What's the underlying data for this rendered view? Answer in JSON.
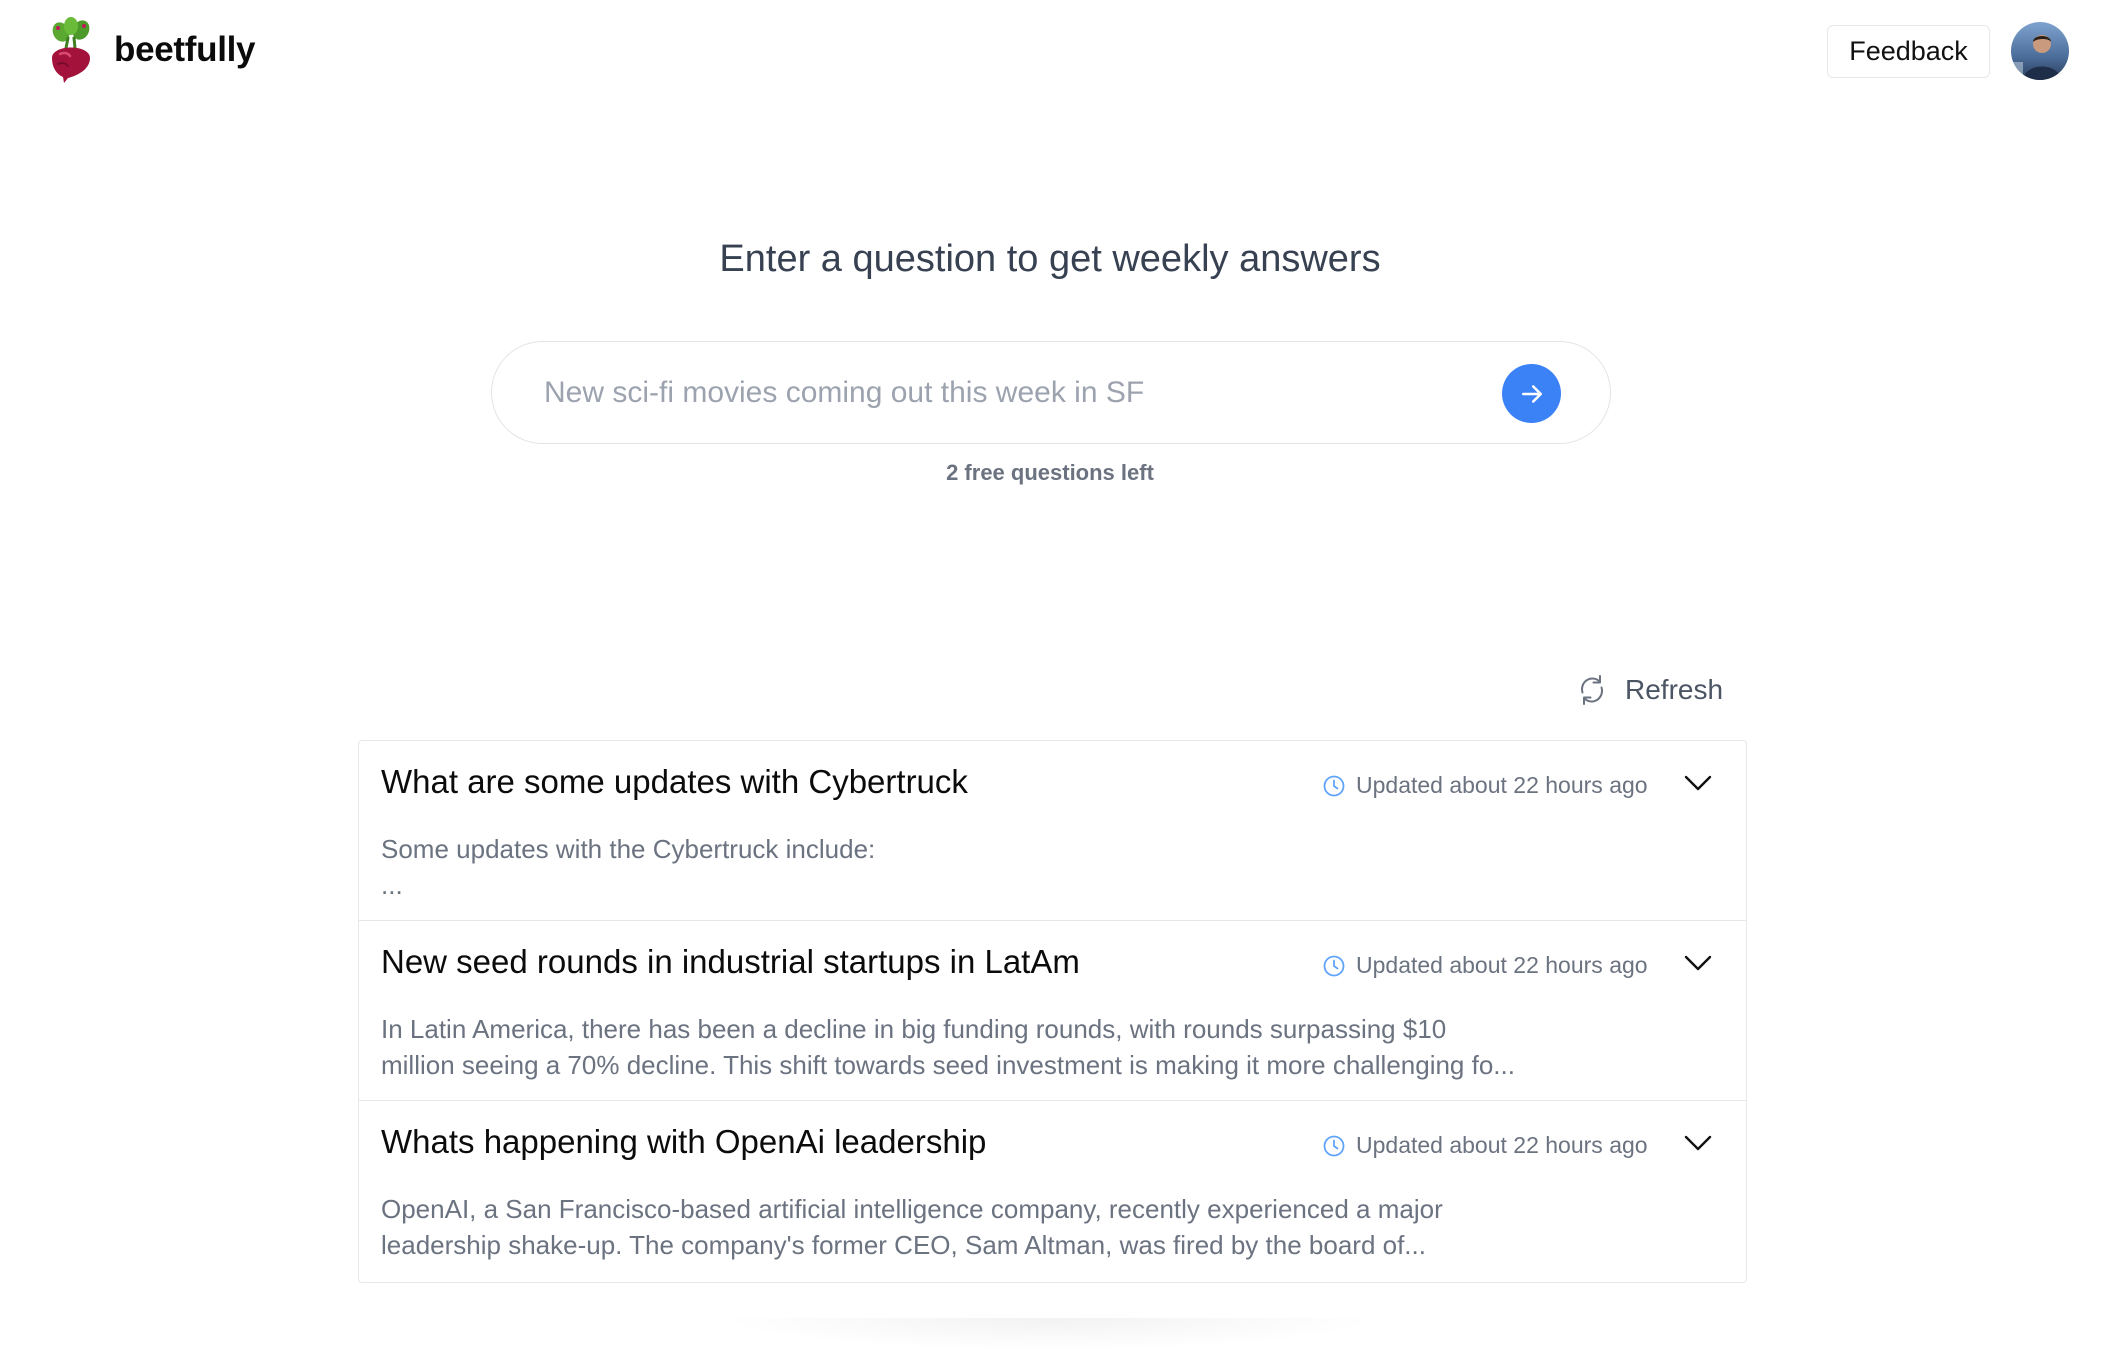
{
  "header": {
    "brand": "beetfully",
    "feedback_label": "Feedback"
  },
  "hero": {
    "title": "Enter a question to get weekly answers",
    "search_placeholder": "New sci-fi movies coming out this week in SF",
    "search_value": "",
    "free_questions": "2 free questions left"
  },
  "refresh_label": "Refresh",
  "questions": [
    {
      "title": "What are some updates with Cybertruck",
      "updated": "Updated about 22 hours ago",
      "summary_line1": "Some updates with the Cybertruck include:",
      "summary_line2": "..."
    },
    {
      "title": "New seed rounds in industrial startups in LatAm",
      "updated": "Updated about 22 hours ago",
      "summary_line1": "In Latin America, there has been a decline in big funding rounds, with rounds surpassing $10",
      "summary_line2": "million seeing a 70% decline. This shift towards seed investment is making it more challenging fo..."
    },
    {
      "title": "Whats happening with OpenAi leadership",
      "updated": "Updated about 22 hours ago",
      "summary_line1": "OpenAI, a San Francisco-based artificial intelligence company, recently experienced a major",
      "summary_line2": "leadership shake-up. The company's former CEO, Sam Altman, was fired by the board of..."
    }
  ],
  "colors": {
    "accent": "#3b82f6",
    "clock_icon": "#60a5fa",
    "border": "#e5e7eb",
    "muted_text": "#6b7280",
    "beet": "#a3123a",
    "leaf": "#4d9a2a"
  },
  "icons": {
    "brand": "beet-icon",
    "submit": "arrow-right-icon",
    "refresh": "refresh-icon",
    "updated": "clock-icon",
    "expand": "chevron-down-icon"
  }
}
